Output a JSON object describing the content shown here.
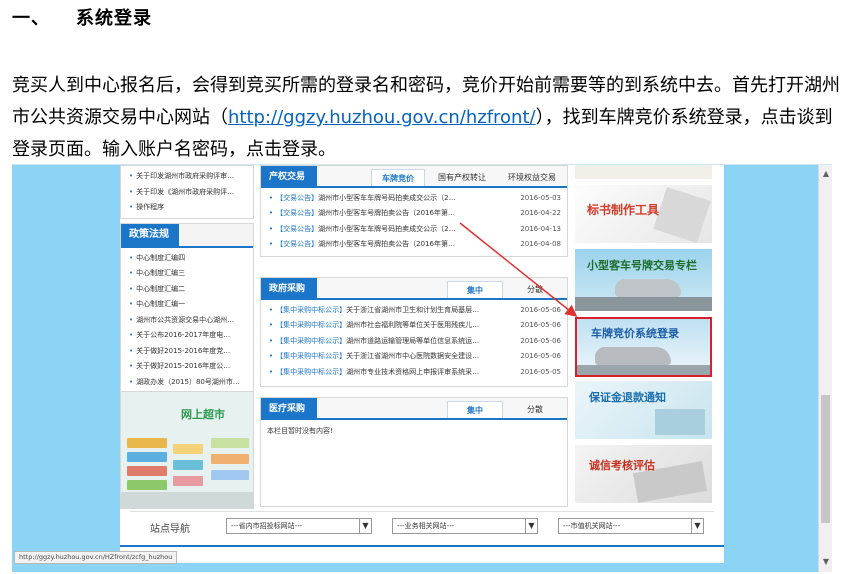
{
  "doc": {
    "heading_num": "一、",
    "heading_text": "系统登录",
    "para_part1": "竞买人到中心报名后，会得到竞买所需的登录名和密码，竞价开始前需要等的到系统中去。首先打开湖州市公共资源交易中心网站（",
    "para_link": "http://ggzy.huzhou.gov.cn/hzfront/",
    "para_part2": "），找到车牌竞价系统登录，点击谈到登录页面。输入账户名密码，点击登录。"
  },
  "site": {
    "top_list": [
      "关于印发湖州市政府采购评审…",
      "关于印发《湖州市政府采购评…",
      "操作程序"
    ],
    "policy_title": "政策法规",
    "policy_list": [
      "中心制度汇编四",
      "中心制度汇编三",
      "中心制度汇编二",
      "中心制度汇编一",
      "湖州市公共资源交易中心湖州…",
      "关于公布2016-2017年度电…",
      "关于做好2015-2016年度党…",
      "关于做好2015-2016年度公…",
      "湖政办发（2015）80号湖州市…"
    ],
    "market_label": "网上超市",
    "property": {
      "title": "产权交易",
      "tabs": [
        "车牌竞价",
        "国有产权转让",
        "环境权益交易"
      ],
      "rows": [
        {
          "tag": "【交易公告】",
          "text": "湖州市小型客车车牌号码拍卖成交公示（2…",
          "date": "2016-05-03"
        },
        {
          "tag": "【交易公告】",
          "text": "湖州市小型客车号牌拍卖公告（2016年第…",
          "date": "2016-04-22"
        },
        {
          "tag": "【交易公告】",
          "text": "湖州市小型客车车牌号码拍卖成交公示（2…",
          "date": "2016-04-13"
        },
        {
          "tag": "【交易公告】",
          "text": "湖州市小型客车号牌拍卖公告（2016年第…",
          "date": "2016-04-08"
        }
      ]
    },
    "procurement": {
      "title": "政府采购",
      "tabs": [
        "集中",
        "分散"
      ],
      "rows": [
        {
          "tag": "【集中采购中标公示】",
          "text": "关于浙江省湖州市卫生和计划生育局基层…",
          "date": "2016-05-06"
        },
        {
          "tag": "【集中采购中标公示】",
          "text": "湖州市社会福利院等单位关于医用残疾儿…",
          "date": "2016-05-06"
        },
        {
          "tag": "【集中采购中标公示】",
          "text": "湖州市道路运输管理局等单位信息系统运…",
          "date": "2016-05-06"
        },
        {
          "tag": "【集中采购中标公示】",
          "text": "关于浙江省湖州市中心医院数据安全建设…",
          "date": "2016-05-06"
        },
        {
          "tag": "【集中采购中标公示】",
          "text": "湖州市专业技术资格网上申报评审系统采…",
          "date": "2016-05-05"
        }
      ]
    },
    "medical": {
      "title": "医疗采购",
      "tabs": [
        "集中",
        "分散"
      ],
      "empty": "本栏目暂时没有内容!"
    },
    "banners": [
      "标书制作工具",
      "小型客车号牌交易专栏",
      "车牌竞价系统登录",
      "保证金退款通知",
      "诚信考核评估"
    ],
    "nav_label": "站点导航",
    "selects": [
      "---省内市招投标网站---",
      "---业务相关网站---",
      "---市值机关网站---"
    ],
    "status_url": "http://ggzy.huzhou.gov.cn/HZfront/zcfg_huzhou"
  },
  "colors": {
    "accent": "#1b76c9",
    "highlight_border": "#d9202a",
    "arrow": "#e03030",
    "side_bg": "#8cd4f5"
  }
}
